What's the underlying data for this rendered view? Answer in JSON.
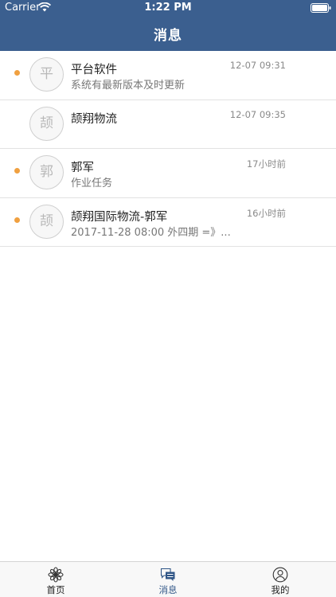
{
  "status_bar": {
    "carrier": "Carrier",
    "time": "1:22 PM"
  },
  "header": {
    "title": "消息"
  },
  "messages": [
    {
      "avatar": "平",
      "title": "平台软件",
      "subtitle": "系统有最新版本及时更新",
      "time": "12-07 09:31",
      "unread": true
    },
    {
      "avatar": "颉",
      "title": "颉翔物流",
      "subtitle": "",
      "time": "12-07 09:35",
      "unread": false
    },
    {
      "avatar": "郭",
      "title": "郭军",
      "subtitle": "作业任务",
      "time": "17小时前",
      "unread": true
    },
    {
      "avatar": "颉",
      "title": "颉翔国际物流-郭军",
      "subtitle": "2017-11-28 08:00 外四期 =》...",
      "time": "16小时前",
      "unread": true
    }
  ],
  "tabs": [
    {
      "label": "首页",
      "icon": "flower-icon"
    },
    {
      "label": "消息",
      "icon": "chat-icon",
      "active": true
    },
    {
      "label": "我的",
      "icon": "user-icon"
    }
  ],
  "colors": {
    "header": "#3b5f8f",
    "unread_dot": "#f0a040",
    "active_tab": "#2f5586"
  }
}
